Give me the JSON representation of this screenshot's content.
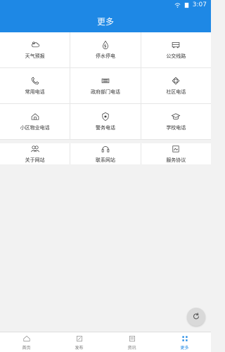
{
  "status": {
    "time": "3:07"
  },
  "header": {
    "title": "更多"
  },
  "grid": [
    [
      {
        "label": "天气预报",
        "icon": "weather-icon"
      },
      {
        "label": "停水停电",
        "icon": "water-drop-icon"
      },
      {
        "label": "公交线路",
        "icon": "bus-icon"
      }
    ],
    [
      {
        "label": "常用电话",
        "icon": "phone-icon"
      },
      {
        "label": "政府部门电话",
        "icon": "keyboard-icon"
      },
      {
        "label": "社区电话",
        "icon": "community-icon"
      }
    ],
    [
      {
        "label": "小区物业电话",
        "icon": "home-icon"
      },
      {
        "label": "警务电话",
        "icon": "police-badge-icon"
      },
      {
        "label": "学校电话",
        "icon": "graduation-cap-icon"
      }
    ]
  ],
  "grid2": [
    {
      "label": "关于网站",
      "icon": "users-icon"
    },
    {
      "label": "联系网站",
      "icon": "headset-icon"
    },
    {
      "label": "服务协议",
      "icon": "document-icon"
    }
  ],
  "nav": [
    {
      "label": "首页",
      "icon": "home-icon"
    },
    {
      "label": "发布",
      "icon": "edit-icon"
    },
    {
      "label": "资讯",
      "icon": "news-icon"
    },
    {
      "label": "更多",
      "icon": "grid-icon",
      "active": true
    }
  ],
  "colors": {
    "primary": "#1e88e5",
    "background": "#f2f2f2"
  }
}
